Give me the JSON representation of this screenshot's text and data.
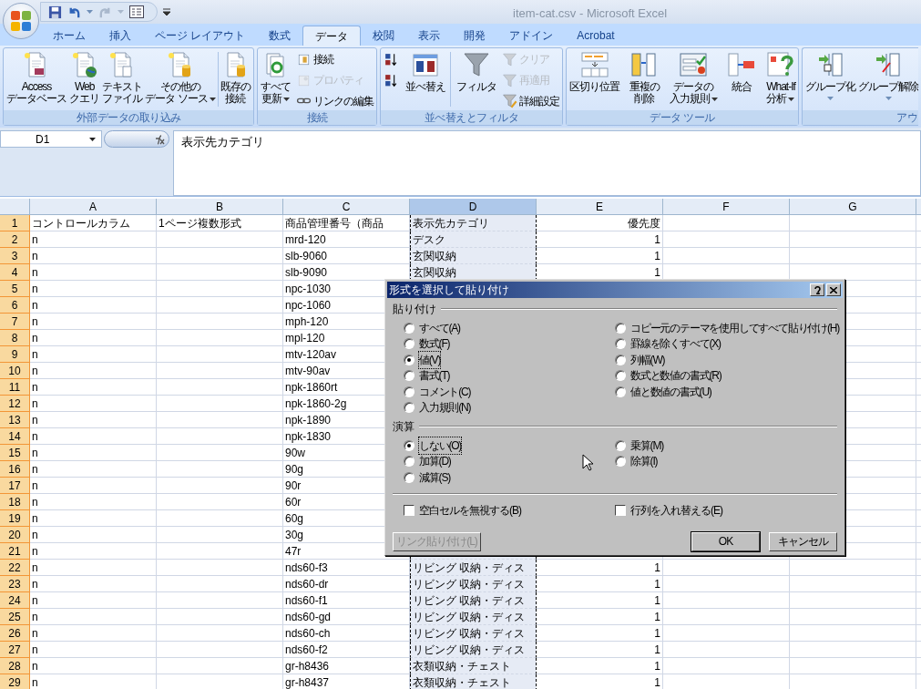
{
  "window": {
    "title": "item-cat.csv - Microsoft Excel"
  },
  "ribbon_tabs": [
    {
      "label": "ホーム",
      "selected": false
    },
    {
      "label": "挿入",
      "selected": false
    },
    {
      "label": "ページ レイアウト",
      "selected": false
    },
    {
      "label": "数式",
      "selected": false
    },
    {
      "label": "データ",
      "selected": true
    },
    {
      "label": "校閲",
      "selected": false
    },
    {
      "label": "表示",
      "selected": false
    },
    {
      "label": "開発",
      "selected": false
    },
    {
      "label": "アドイン",
      "selected": false
    },
    {
      "label": "Acrobat",
      "selected": false
    }
  ],
  "ribbon_groups": [
    {
      "label": "外部データの取り込み",
      "buttons": [
        {
          "kind": "large",
          "lines": [
            "Access",
            "データベース"
          ]
        },
        {
          "kind": "large",
          "lines": [
            "Web",
            "クエリ"
          ]
        },
        {
          "kind": "large",
          "lines": [
            "テキスト",
            "ファイル"
          ]
        },
        {
          "kind": "large",
          "lines": [
            "その他の",
            "データ ソース"
          ],
          "dropdown": true
        },
        {
          "kind": "large",
          "lines": [
            "既存の",
            "接続"
          ],
          "separator_before": true
        }
      ]
    },
    {
      "label": "接続",
      "buttons": [
        {
          "kind": "large",
          "lines": [
            "すべて",
            "更新"
          ],
          "dropdown": true
        },
        {
          "kind": "stack",
          "items": [
            {
              "label": "接続",
              "disabled": false
            },
            {
              "label": "プロパティ",
              "disabled": true
            },
            {
              "label": "リンクの編集",
              "disabled": false
            }
          ]
        }
      ]
    },
    {
      "label": "並べ替えとフィルタ",
      "buttons": [
        {
          "kind": "stack",
          "items": [
            {
              "disabled": false
            },
            {
              "disabled": false
            }
          ]
        },
        {
          "kind": "large",
          "lines": [
            "並べ替え"
          ]
        },
        {
          "kind": "large",
          "lines": [
            "フィルタ"
          ],
          "separator_before": true
        },
        {
          "kind": "stack",
          "items": [
            {
              "label": "クリア",
              "disabled": true
            },
            {
              "label": "再適用",
              "disabled": true
            },
            {
              "label": "詳細設定",
              "disabled": false
            }
          ]
        }
      ]
    },
    {
      "label": "データ ツール",
      "buttons": [
        {
          "kind": "large",
          "lines": [
            "区切り位置"
          ]
        },
        {
          "kind": "large",
          "lines": [
            "重複の",
            "削除"
          ]
        },
        {
          "kind": "large",
          "lines": [
            "データの",
            "入力規則"
          ],
          "dropdown": true
        },
        {
          "kind": "large",
          "lines": [
            "統合"
          ]
        },
        {
          "kind": "large",
          "lines": [
            "What-If",
            "分析"
          ],
          "dropdown": true
        }
      ]
    },
    {
      "label": "アウ",
      "buttons": [
        {
          "kind": "large",
          "lines": [
            "グループ化"
          ],
          "dropdown": true
        },
        {
          "kind": "large",
          "lines": [
            "グループ解除"
          ],
          "dropdown": true
        }
      ]
    }
  ],
  "formula_bar": {
    "name_box": "D1",
    "formula": "表示先カテゴリ"
  },
  "sheet": {
    "columns": [
      {
        "label": "A",
        "selected": false
      },
      {
        "label": "B",
        "selected": false
      },
      {
        "label": "C",
        "selected": false
      },
      {
        "label": "D",
        "selected": true
      },
      {
        "label": "E",
        "selected": false
      },
      {
        "label": "F",
        "selected": false
      },
      {
        "label": "G",
        "selected": false
      }
    ],
    "rows": [
      {
        "num": "1",
        "a": "コントロールカラム",
        "b": "1ページ複数形式",
        "c": "商品管理番号（商品",
        "d": "表示先カテゴリ",
        "e": "優先度"
      },
      {
        "num": "2",
        "a": "n",
        "c": "mrd-120",
        "d": "デスク",
        "e": "1"
      },
      {
        "num": "3",
        "a": "n",
        "c": "slb-9060",
        "d": "玄関収納",
        "e": "1"
      },
      {
        "num": "4",
        "a": "n",
        "c": "slb-9090",
        "d": "玄関収納",
        "e": "1"
      },
      {
        "num": "5",
        "a": "n",
        "c": "npc-1030"
      },
      {
        "num": "6",
        "a": "n",
        "c": "npc-1060"
      },
      {
        "num": "7",
        "a": "n",
        "c": "mph-120"
      },
      {
        "num": "8",
        "a": "n",
        "c": "mpl-120"
      },
      {
        "num": "9",
        "a": "n",
        "c": "mtv-120av"
      },
      {
        "num": "10",
        "a": "n",
        "c": "mtv-90av"
      },
      {
        "num": "11",
        "a": "n",
        "c": "npk-1860rt"
      },
      {
        "num": "12",
        "a": "n",
        "c": "npk-1860-2g"
      },
      {
        "num": "13",
        "a": "n",
        "c": "npk-1890"
      },
      {
        "num": "14",
        "a": "n",
        "c": "npk-1830"
      },
      {
        "num": "15",
        "a": "n",
        "c": "90w"
      },
      {
        "num": "16",
        "a": "n",
        "c": "90g"
      },
      {
        "num": "17",
        "a": "n",
        "c": "90r"
      },
      {
        "num": "18",
        "a": "n",
        "c": "60r"
      },
      {
        "num": "19",
        "a": "n",
        "c": "60g"
      },
      {
        "num": "20",
        "a": "n",
        "c": "30g"
      },
      {
        "num": "21",
        "a": "n",
        "c": "47r"
      },
      {
        "num": "22",
        "a": "n",
        "c": "nds60-f3",
        "d": "リビング 収納・ディス",
        "e": "1"
      },
      {
        "num": "23",
        "a": "n",
        "c": "nds60-dr",
        "d": "リビング 収納・ディス",
        "e": "1"
      },
      {
        "num": "24",
        "a": "n",
        "c": "nds60-f1",
        "d": "リビング 収納・ディス",
        "e": "1"
      },
      {
        "num": "25",
        "a": "n",
        "c": "nds60-gd",
        "d": "リビング 収納・ディス",
        "e": "1"
      },
      {
        "num": "26",
        "a": "n",
        "c": "nds60-ch",
        "d": "リビング 収納・ディス",
        "e": "1"
      },
      {
        "num": "27",
        "a": "n",
        "c": "nds60-f2",
        "d": "リビング 収納・ディス",
        "e": "1"
      },
      {
        "num": "28",
        "a": "n",
        "c": "gr-h8436",
        "d": "衣類収納・チェスト",
        "e": "1"
      },
      {
        "num": "29",
        "a": "n",
        "c": "gr-h8437",
        "d": "衣類収納・チェスト",
        "e": "1"
      }
    ]
  },
  "dialog": {
    "title": "形式を選択して貼り付け",
    "paste_section": "貼り付け",
    "paste_left": [
      {
        "label": "すべて(A)",
        "selected": false
      },
      {
        "label": "数式(F)",
        "selected": false
      },
      {
        "label": "値(V)",
        "selected": true
      },
      {
        "label": "書式(T)",
        "selected": false
      },
      {
        "label": "コメント(C)",
        "selected": false
      },
      {
        "label": "入力規則(N)",
        "selected": false
      }
    ],
    "paste_right": [
      {
        "label": "コピー元のテーマを使用してすべて貼り付け(H)",
        "selected": false
      },
      {
        "label": "罫線を除くすべて(X)",
        "selected": false
      },
      {
        "label": "列幅(W)",
        "selected": false
      },
      {
        "label": "数式と数値の書式(R)",
        "selected": false
      },
      {
        "label": "値と数値の書式(U)",
        "selected": false
      }
    ],
    "operation_section": "演算",
    "operation_left": [
      {
        "label": "しない(O)",
        "selected": true
      },
      {
        "label": "加算(D)",
        "selected": false
      },
      {
        "label": "減算(S)",
        "selected": false
      }
    ],
    "operation_right": [
      {
        "label": "乗算(M)",
        "selected": false
      },
      {
        "label": "除算(I)",
        "selected": false
      }
    ],
    "checkboxes": [
      {
        "label": "空白セルを無視する(B)",
        "checked": false
      },
      {
        "label": "行列を入れ替える(E)",
        "checked": false
      }
    ],
    "buttons": [
      {
        "label": "リンク貼り付け(L)",
        "disabled": true,
        "default": false
      },
      {
        "label": "OK",
        "disabled": false,
        "default": true
      },
      {
        "label": "キャンセル",
        "disabled": false,
        "default": false
      }
    ]
  }
}
